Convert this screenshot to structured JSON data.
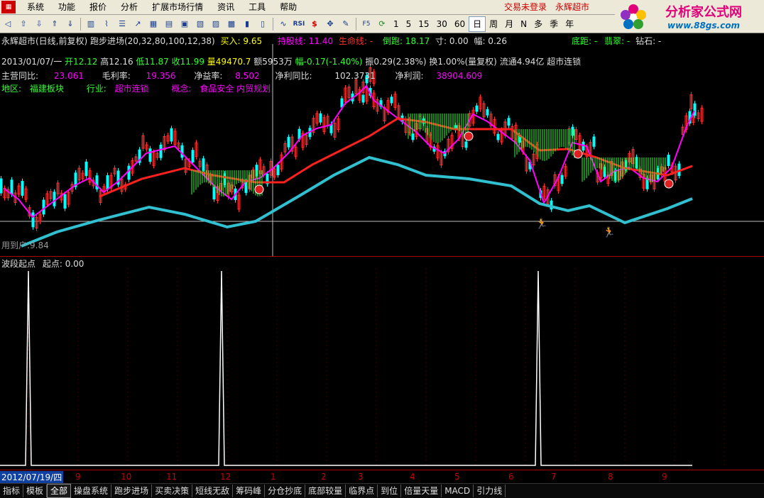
{
  "menu": {
    "items": [
      "系统",
      "功能",
      "报价",
      "分析",
      "扩展市场行情",
      "资讯",
      "工具",
      "帮助"
    ],
    "status_right": [
      "交易未登录",
      "永辉超市"
    ]
  },
  "toolbar": {
    "periods": [
      "1",
      "5",
      "15",
      "30",
      "60",
      "日",
      "周",
      "月",
      "N",
      "多",
      "季",
      "年"
    ],
    "active_period": "日"
  },
  "brand": {
    "name": "分析家公式网",
    "url": "www.88gs.com"
  },
  "header": {
    "title": "永辉超市(日线,前复权) 跑步进场(20,32,80,100,12,38)",
    "buy_label": "买入: 9.65",
    "hold_label": "持股线: 11.40",
    "life_label": "生命线: -",
    "run_label": "倒跑: 18.17",
    "cun_label": "寸: 0.00",
    "fu_label": "幅: 0.26",
    "dilu_label": "底距: -",
    "fei_label": "翡翠: -",
    "extra_label": "钻石: -"
  },
  "quote": {
    "date": "2013/01/07/一",
    "open": "开12.12",
    "high": "高12.16",
    "low": "低11.87",
    "close": "收11.99",
    "vol": "量49470.7",
    "amount": "额5953万",
    "change": "幅-0.17(-1.40%)",
    "amp": "振0.29(2.38%)",
    "turnover": "换1.00%(量复权)",
    "float": "流通4.94亿",
    "sector": "超市连锁"
  },
  "fundamental": {
    "rev_label": "主营同比:",
    "rev_value": "23.061",
    "margin_label": "毛利率:",
    "margin_value": "19.356",
    "netrate_label": "净益率:",
    "netrate_value": "8.502",
    "netgrowth_label": "净利同比:",
    "netgrowth_value": "102.3731",
    "profit_label": "净利润:",
    "profit_value": "38904.609"
  },
  "region": {
    "region_label": "地区:",
    "region_value": "福建板块",
    "industry_label": "行业:",
    "industry_value": "超市连锁",
    "concept_label": "概念:",
    "concept_value": "食品安全 内贸规划"
  },
  "low_note": "用到户:9.84",
  "panel2": {
    "title": "波段起点",
    "value_label": "起点: 0.00"
  },
  "axis": {
    "start_date": "2012/07/19/四",
    "months": [
      "9",
      "10",
      "11",
      "12",
      "1",
      "2",
      "3",
      "4",
      "5",
      "6",
      "7",
      "8",
      "9"
    ]
  },
  "tabs": [
    "指标",
    "模板",
    "全部",
    "操盘系统",
    "跑步进场",
    "买卖决策",
    "短线无敌",
    "筹码峰",
    "分仓抄底",
    "底部较量",
    "临界点",
    "到位",
    "倍量天量",
    "MACD",
    "引力线"
  ],
  "active_tab": "全部",
  "colors": {
    "up": "#ff3030",
    "down": "#00ffff",
    "ma_fast": "#ff00ff",
    "ma_red": "#ff2020",
    "ma_cyan": "#30c0d0",
    "fill_green": "#30ff30"
  }
}
